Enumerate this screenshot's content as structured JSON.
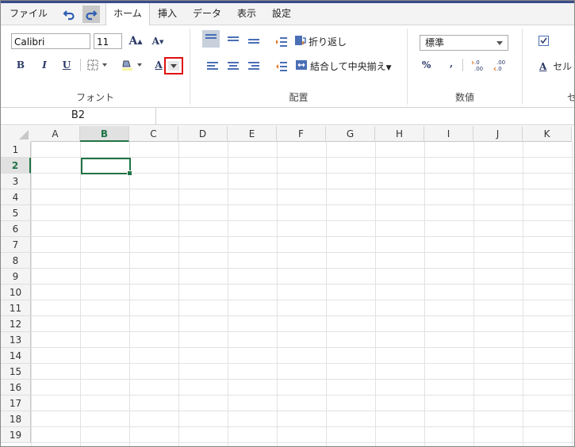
{
  "menubar": {
    "items": [
      "ファイル",
      "ホーム",
      "挿入",
      "データ",
      "表示",
      "設定"
    ]
  },
  "font_group": {
    "font_name": "Calibri",
    "font_size": "11",
    "label": "フォント",
    "bold": "B",
    "italic": "I",
    "underline": "U",
    "font_color_glyph": "A"
  },
  "align_group": {
    "wrap_text": "折り返し",
    "merge_center": "結合して中央揃え",
    "label": "配置"
  },
  "number_group": {
    "format": "標準",
    "percent": "%",
    "comma": ",",
    "label": "数値"
  },
  "cell_group": {
    "cell_style_fragment": "セル",
    "label_fragment": "セ"
  },
  "formula_bar": {
    "name_box": "B2"
  },
  "grid": {
    "columns": [
      "A",
      "B",
      "C",
      "D",
      "E",
      "F",
      "G",
      "H",
      "I",
      "J",
      "K"
    ],
    "rows": [
      "1",
      "2",
      "3",
      "4",
      "5",
      "6",
      "7",
      "8",
      "9",
      "10",
      "11",
      "12",
      "13",
      "14",
      "15",
      "16",
      "17",
      "18",
      "19"
    ],
    "selected_column": "B",
    "selected_row": "2"
  },
  "colors": {
    "accent_green": "#217346",
    "highlight_red": "#e01010",
    "ribbon_icon_blue": "#4a6fb5"
  }
}
